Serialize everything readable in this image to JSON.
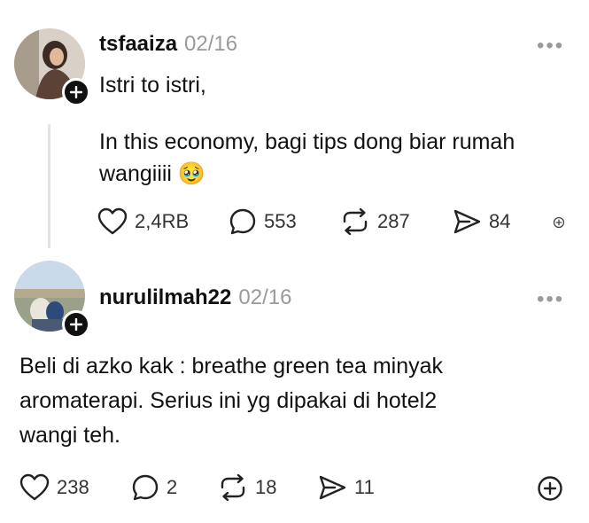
{
  "post1": {
    "username": "tsfaaiza",
    "date": "02/16",
    "lines": [
      "Istri to istri,",
      "In this economy, bagi tips dong biar rumah",
      "wangiiii 🥹"
    ],
    "likes": "2,4RB",
    "replies": "553",
    "reposts": "287",
    "shares": "84"
  },
  "post2": {
    "username": "nurulilmah22",
    "date": "02/16",
    "lines": [
      "Beli di azko kak : breathe green tea minyak",
      "aromaterapi. Serius ini yg dipakai di hotel2",
      "wangi teh."
    ],
    "likes": "238",
    "replies": "2",
    "reposts": "18",
    "shares": "11"
  },
  "more_label": "•••"
}
